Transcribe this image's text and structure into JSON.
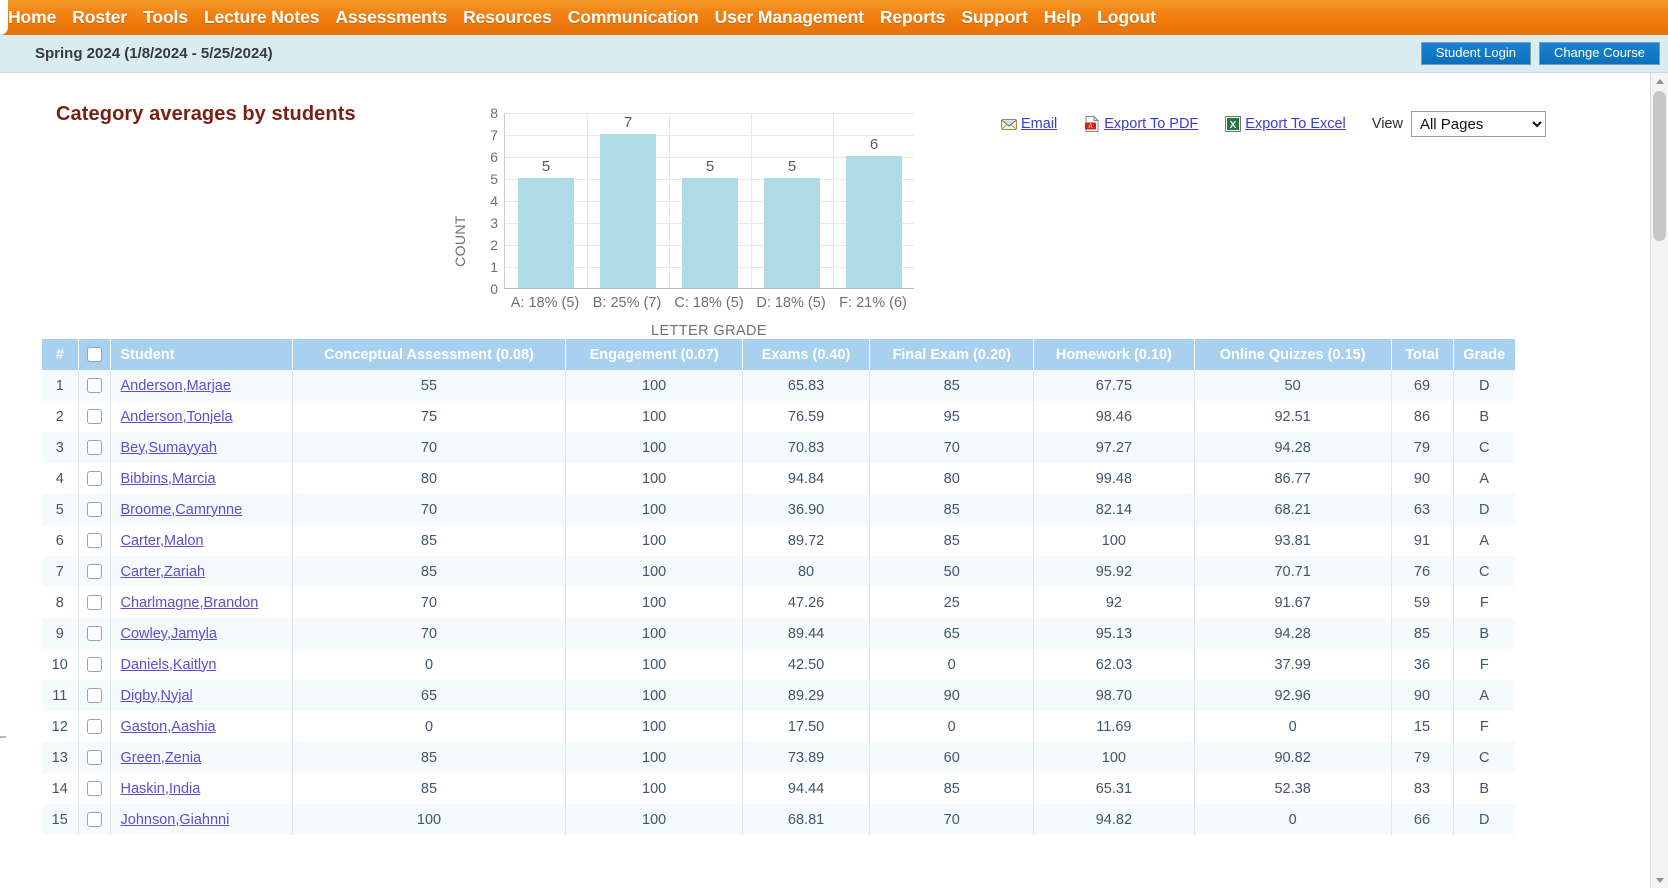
{
  "nav": {
    "items": [
      {
        "label": "Home"
      },
      {
        "label": "Roster"
      },
      {
        "label": "Tools"
      },
      {
        "label": "Lecture Notes"
      },
      {
        "label": "Assessments"
      },
      {
        "label": "Resources"
      },
      {
        "label": "Communication"
      },
      {
        "label": "User Management"
      },
      {
        "label": "Reports"
      },
      {
        "label": "Support"
      },
      {
        "label": "Help"
      },
      {
        "label": "Logout"
      }
    ]
  },
  "header": {
    "term": "Spring 2024 (1/8/2024 - 5/25/2024)",
    "student_login_label": "Student Login",
    "change_course_label": "Change Course",
    "button_color": "#1277c4",
    "bar_color": "#ef7c0d",
    "subheader_color": "#d9ecf2"
  },
  "page": {
    "title": "Category averages by students",
    "title_color": "#7b1f14"
  },
  "toolbar": {
    "email_label": "Email",
    "email_icon": "envelope-icon",
    "pdf_label": "Export To PDF",
    "pdf_icon": "pdf-icon",
    "excel_label": "Export To Excel",
    "excel_icon": "excel-icon",
    "view_label": "View",
    "view_selected": "All Pages",
    "view_options": [
      "All Pages"
    ],
    "link_color": "#3b3bcf"
  },
  "chart_data": {
    "type": "bar",
    "title": "",
    "xlabel": "LETTER GRADE",
    "ylabel": "COUNT",
    "categories": [
      "A: 18% (5)",
      "B: 25% (7)",
      "C: 18% (5)",
      "D: 18% (5)",
      "F: 21% (6)"
    ],
    "values": [
      5,
      7,
      5,
      5,
      6
    ],
    "data_labels": [
      "5",
      "7",
      "5",
      "5",
      "6"
    ],
    "ylim": [
      0,
      8
    ],
    "yticks": [
      "0",
      "1",
      "2",
      "3",
      "4",
      "5",
      "6",
      "7",
      "8"
    ],
    "grid": true,
    "legend": "none",
    "bar_color": "#aedbe6",
    "axis_text_color": "#6b7177"
  },
  "table": {
    "header_color": "#a8d0ef",
    "columns": [
      "#",
      "",
      "Student",
      "Conceptual Assessment (0.08)",
      "Engagement (0.07)",
      "Exams (0.40)",
      "Final Exam (0.20)",
      "Homework (0.10)",
      "Online Quizzes (0.15)",
      "Total",
      "Grade"
    ],
    "rows": [
      {
        "num": "1",
        "student": "Anderson,Marjae",
        "conceptual": "55",
        "engagement": "100",
        "exams": "65.83",
        "final": "85",
        "homework": "67.75",
        "quizzes": "50",
        "total": "69",
        "grade": "D"
      },
      {
        "num": "2",
        "student": "Anderson,Tonjela",
        "conceptual": "75",
        "engagement": "100",
        "exams": "76.59",
        "final": "95",
        "homework": "98.46",
        "quizzes": "92.51",
        "total": "86",
        "grade": "B"
      },
      {
        "num": "3",
        "student": "Bey,Sumayyah",
        "conceptual": "70",
        "engagement": "100",
        "exams": "70.83",
        "final": "70",
        "homework": "97.27",
        "quizzes": "94.28",
        "total": "79",
        "grade": "C"
      },
      {
        "num": "4",
        "student": "Bibbins,Marcia",
        "conceptual": "80",
        "engagement": "100",
        "exams": "94.84",
        "final": "80",
        "homework": "99.48",
        "quizzes": "86.77",
        "total": "90",
        "grade": "A"
      },
      {
        "num": "5",
        "student": "Broome,Camrynne",
        "conceptual": "70",
        "engagement": "100",
        "exams": "36.90",
        "final": "85",
        "homework": "82.14",
        "quizzes": "68.21",
        "total": "63",
        "grade": "D"
      },
      {
        "num": "6",
        "student": "Carter,Malon",
        "conceptual": "85",
        "engagement": "100",
        "exams": "89.72",
        "final": "85",
        "homework": "100",
        "quizzes": "93.81",
        "total": "91",
        "grade": "A"
      },
      {
        "num": "7",
        "student": "Carter,Zariah",
        "conceptual": "85",
        "engagement": "100",
        "exams": "80",
        "final": "50",
        "homework": "95.92",
        "quizzes": "70.71",
        "total": "76",
        "grade": "C"
      },
      {
        "num": "8",
        "student": "Charlmagne,Brandon",
        "conceptual": "70",
        "engagement": "100",
        "exams": "47.26",
        "final": "25",
        "homework": "92",
        "quizzes": "91.67",
        "total": "59",
        "grade": "F"
      },
      {
        "num": "9",
        "student": "Cowley,Jamyla",
        "conceptual": "70",
        "engagement": "100",
        "exams": "89.44",
        "final": "65",
        "homework": "95.13",
        "quizzes": "94.28",
        "total": "85",
        "grade": "B"
      },
      {
        "num": "10",
        "student": "Daniels,Kaitlyn",
        "conceptual": "0",
        "engagement": "100",
        "exams": "42.50",
        "final": "0",
        "homework": "62.03",
        "quizzes": "37.99",
        "total": "36",
        "grade": "F"
      },
      {
        "num": "11",
        "student": "Digby,Nyjal",
        "conceptual": "65",
        "engagement": "100",
        "exams": "89.29",
        "final": "90",
        "homework": "98.70",
        "quizzes": "92.96",
        "total": "90",
        "grade": "A"
      },
      {
        "num": "12",
        "student": "Gaston,Aashia",
        "conceptual": "0",
        "engagement": "100",
        "exams": "17.50",
        "final": "0",
        "homework": "11.69",
        "quizzes": "0",
        "total": "15",
        "grade": "F"
      },
      {
        "num": "13",
        "student": "Green,Zenia",
        "conceptual": "85",
        "engagement": "100",
        "exams": "73.89",
        "final": "60",
        "homework": "100",
        "quizzes": "90.82",
        "total": "79",
        "grade": "C"
      },
      {
        "num": "14",
        "student": "Haskin,India",
        "conceptual": "85",
        "engagement": "100",
        "exams": "94.44",
        "final": "85",
        "homework": "65.31",
        "quizzes": "52.38",
        "total": "83",
        "grade": "B"
      },
      {
        "num": "15",
        "student": "Johnson,Giahnni",
        "conceptual": "100",
        "engagement": "100",
        "exams": "68.81",
        "final": "70",
        "homework": "94.82",
        "quizzes": "0",
        "total": "66",
        "grade": "D"
      }
    ]
  }
}
